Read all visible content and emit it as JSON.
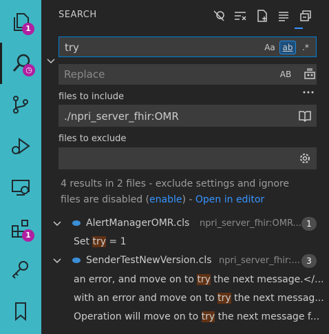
{
  "activity_bar": {
    "explorer_badge": "1",
    "search_badge_icon": "clock-icon",
    "extensions_badge": "1"
  },
  "search_panel": {
    "title": "SEARCH",
    "search_value": "try",
    "replace_placeholder": "Replace",
    "options": {
      "match_case": "Aa",
      "whole_word": "ab",
      "regex": ".*",
      "preserve_case": "AB"
    },
    "files_include_label": "files to include",
    "files_include_value": "./npri_server_fhir:OMR",
    "files_exclude_label": "files to exclude",
    "files_exclude_value": "",
    "message_prefix": "4 results in 2 files - exclude settings and ignore files are disabled (",
    "enable_link": "enable",
    "message_mid": ") - ",
    "open_editor_link": "Open in editor"
  },
  "results": [
    {
      "file": "AlertManagerOMR.cls",
      "path": "npri_server_fhir:OMR...",
      "count": "1",
      "matches": [
        {
          "before": "Set ",
          "hit": "try",
          "after": " = 1"
        }
      ]
    },
    {
      "file": "SenderTestNewVersion.cls",
      "path": "npri_server_fhir:...",
      "count": "3",
      "matches": [
        {
          "before": "an error, and move on to ",
          "hit": "try",
          "after": " the next message.</..."
        },
        {
          "before": "with an error and move on to ",
          "hit": "try",
          "after": " the next messag..."
        },
        {
          "before": "Operation will move on to ",
          "hit": "try",
          "after": " the next message f..."
        }
      ]
    }
  ],
  "colors": {
    "activity_bg": "#3fb6c4",
    "panel_bg": "#252526",
    "link": "#3794ff",
    "badge": "#b020a0",
    "match_highlight": "#613214"
  }
}
